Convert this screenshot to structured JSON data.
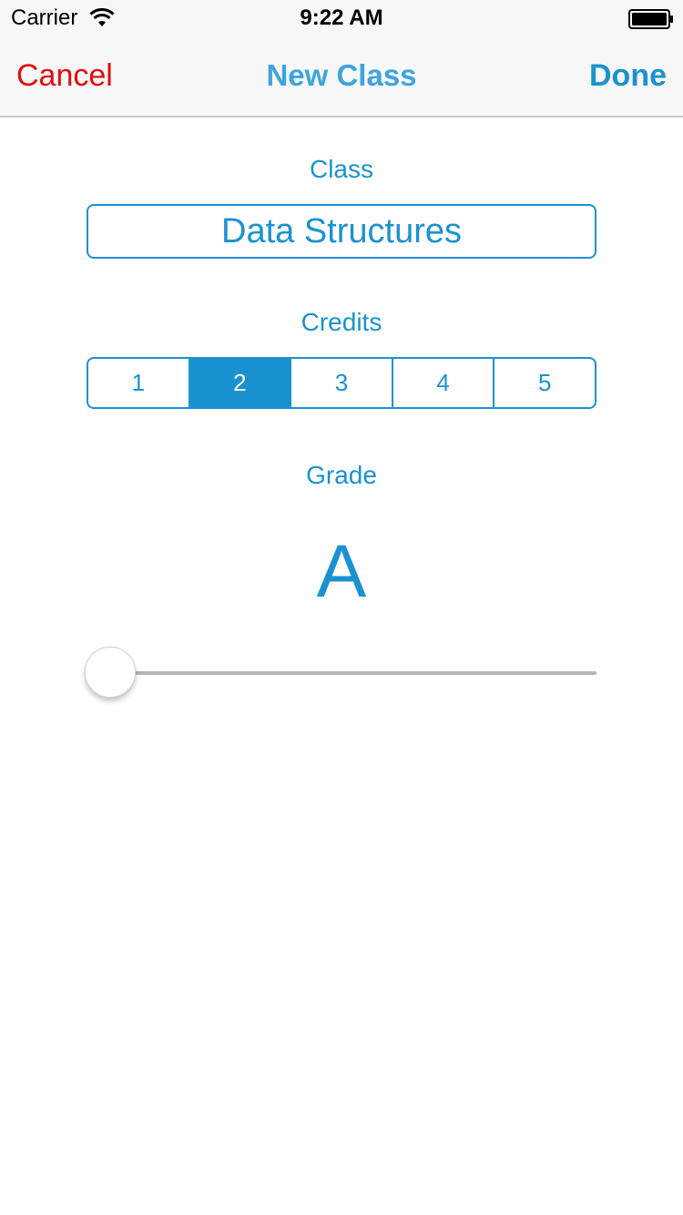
{
  "status_bar": {
    "carrier": "Carrier",
    "time": "9:22 AM",
    "wifi_icon": "wifi-icon",
    "battery_icon": "battery-full-icon"
  },
  "nav": {
    "cancel_label": "Cancel",
    "title": "New Class",
    "done_label": "Done"
  },
  "form": {
    "class_label": "Class",
    "class_value": "Data Structures",
    "credits_label": "Credits",
    "credits_options": [
      "1",
      "2",
      "3",
      "4",
      "5"
    ],
    "credits_selected": "2",
    "grade_label": "Grade",
    "grade_value": "A",
    "grade_slider_level": 0
  },
  "colors": {
    "accent": "#1a92d1",
    "cancel": "#e50b0b",
    "nav_background": "#f7f7f7"
  }
}
